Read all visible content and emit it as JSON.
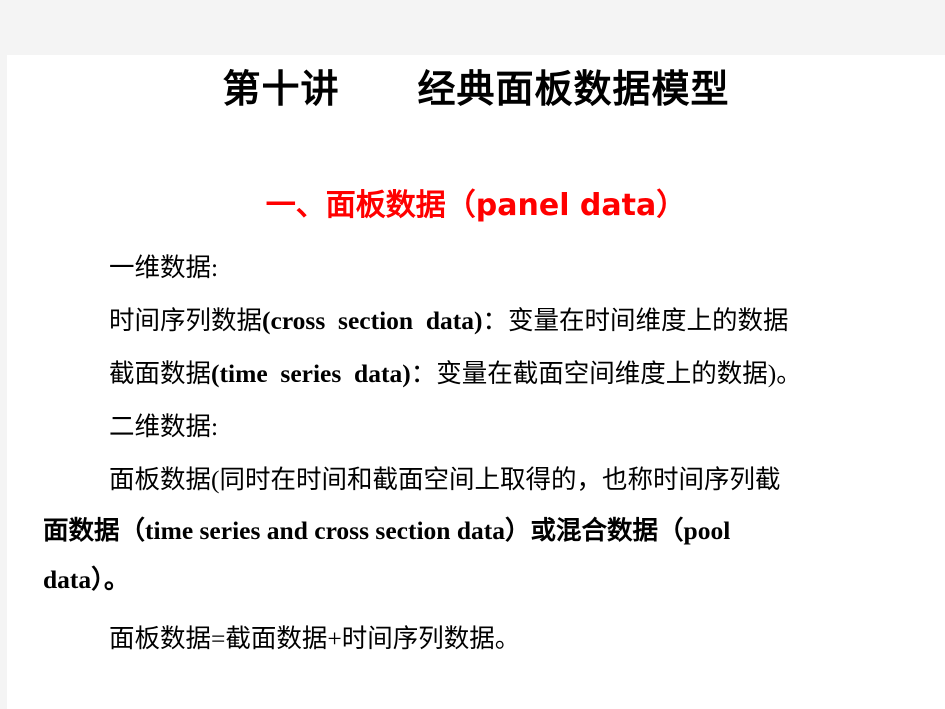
{
  "slide": {
    "title": "第十讲　　经典面板数据模型",
    "section_heading": "一、面板数据（panel data）",
    "heading_color": "#ff0000",
    "lines": [
      {
        "id": "line-1d-label",
        "text": "一维数据:"
      },
      {
        "id": "line-time-series",
        "prefix": "时间序列数据",
        "term": "(cross  section  data)",
        "suffix": "：变量在时间维度上的数据"
      },
      {
        "id": "line-cross-section",
        "prefix": "截面数据",
        "term": "(time  series  data)",
        "suffix": "：变量在截面空间维度上的数据)。"
      },
      {
        "id": "line-2d-label",
        "text": "二维数据:"
      },
      {
        "id": "line-panel-def-1",
        "text": "面板数据(同时在时间和截面空间上取得的，也称时间序列截"
      },
      {
        "id": "line-panel-def-2",
        "text": "面数据（time  series  and  cross  section  data）或混合数据（pool"
      },
      {
        "id": "line-panel-def-3",
        "text": "data）。"
      },
      {
        "id": "line-panel-formula",
        "text": "面板数据=截面数据+时间序列数据。"
      }
    ]
  }
}
